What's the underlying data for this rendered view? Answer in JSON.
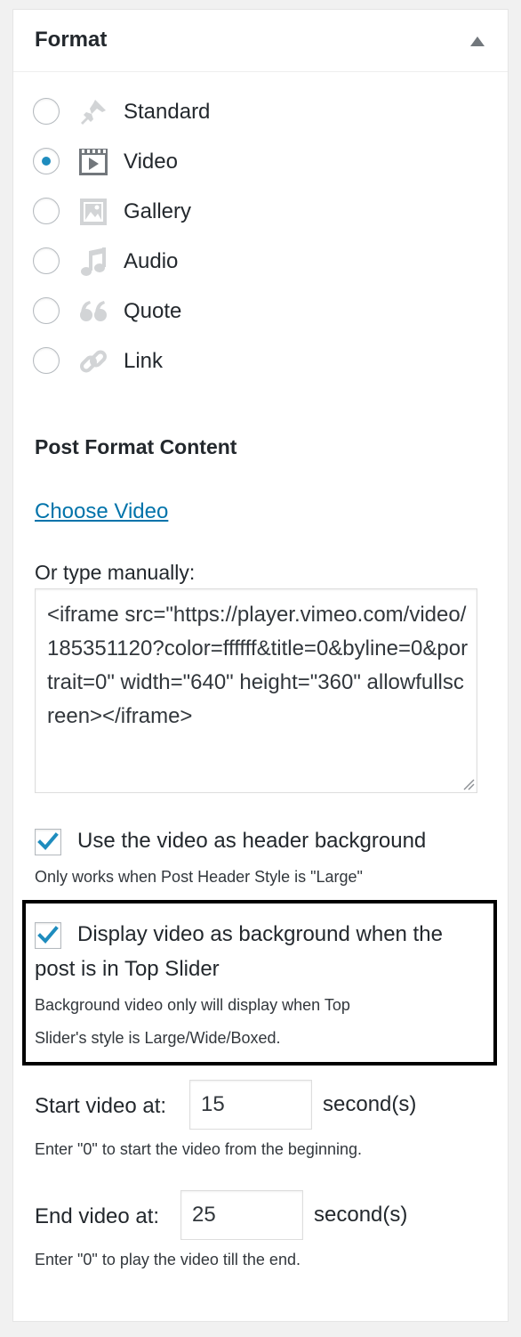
{
  "panel": {
    "title": "Format",
    "toggle_icon": "triangle-up-icon"
  },
  "formats": [
    {
      "label": "Standard",
      "icon": "pin-icon",
      "checked": false
    },
    {
      "label": "Video",
      "icon": "video-icon",
      "checked": true
    },
    {
      "label": "Gallery",
      "icon": "gallery-icon",
      "checked": false
    },
    {
      "label": "Audio",
      "icon": "music-note-icon",
      "checked": false
    },
    {
      "label": "Quote",
      "icon": "quote-icon",
      "checked": false
    },
    {
      "label": "Link",
      "icon": "link-icon",
      "checked": false
    }
  ],
  "content": {
    "heading": "Post Format Content",
    "choose_link": "Choose Video",
    "manual_label": "Or type manually:",
    "embed_code": "<iframe src=\"https://player.vimeo.com/video/185351120?color=ffffff&title=0&byline=0&portrait=0\" width=\"640\" height=\"360\" allowfullscreen></iframe>"
  },
  "options": {
    "header_bg": {
      "label": "Use the video as header background",
      "help": "Only works when Post Header Style is \"Large\"",
      "checked": true
    },
    "slider_bg": {
      "label_line1": "Display video as background when the",
      "label_line2": "post is in Top Slider",
      "help_line1": "Background video only will display when Top",
      "help_line2": "Slider's style is Large/Wide/Boxed.",
      "checked": true
    }
  },
  "timing": {
    "start": {
      "label": "Start video at:",
      "value": "15",
      "unit": "second(s)",
      "help": "Enter \"0\" to start the video from the beginning."
    },
    "end": {
      "label": "End video at:",
      "value": "25",
      "unit": "second(s)",
      "help": "Enter \"0\" to play the video till the end."
    }
  },
  "colors": {
    "accent": "#1e8cbe",
    "link": "#0073aa",
    "icon_inactive": "#d2d4d6",
    "icon_active": "#72777c"
  }
}
